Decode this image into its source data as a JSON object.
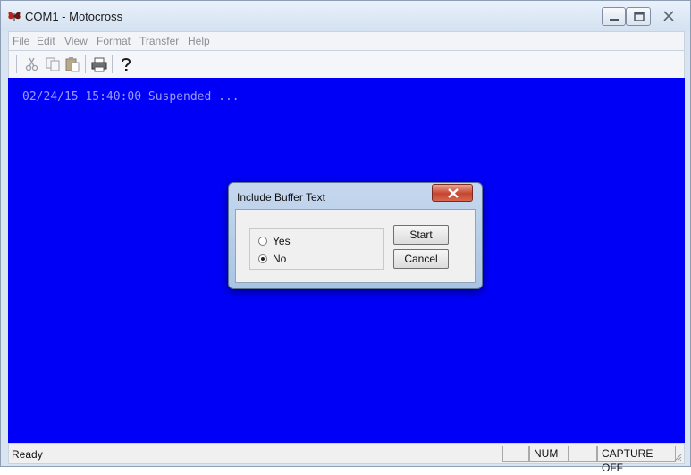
{
  "window": {
    "title": "COM1 - Motocross",
    "app_icon": "butterfly-app-icon",
    "controls": [
      "minimize-icon",
      "maximize-icon",
      "close-icon"
    ]
  },
  "menubar": {
    "items": [
      {
        "label": "File"
      },
      {
        "label": "Edit"
      },
      {
        "label": "View"
      },
      {
        "label": "Format"
      },
      {
        "label": "Transfer"
      },
      {
        "label": "Help"
      }
    ]
  },
  "toolbar": {
    "icons": [
      "cut-icon",
      "copy-icon",
      "paste-icon",
      "print-icon",
      "help-icon"
    ]
  },
  "terminal": {
    "lines": [
      "02/24/15 15:40:00 Suspended ..."
    ],
    "background_color": "#0000f7",
    "text_color": "#9b9bfa"
  },
  "dialog": {
    "title": "Include Buffer Text",
    "options": [
      {
        "label": "Yes",
        "selected": false
      },
      {
        "label": "No",
        "selected": true
      }
    ],
    "start_label": "Start",
    "cancel_label": "Cancel"
  },
  "statusbar": {
    "text": "Ready",
    "num": "NUM",
    "capture": "CAPTURE OFF"
  }
}
